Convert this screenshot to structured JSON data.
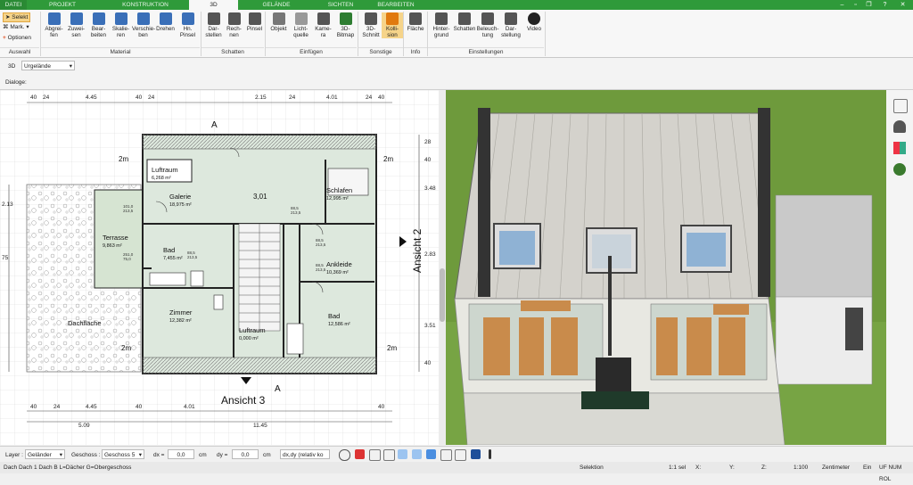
{
  "tabs": [
    {
      "label": "DATEI"
    },
    {
      "label": "PROJEKT"
    },
    {
      "label": "KONSTRUKTION"
    },
    {
      "label": "3D"
    },
    {
      "label": "GELÄNDE"
    },
    {
      "label": "SICHTEN"
    },
    {
      "label": "BEARBEITEN"
    }
  ],
  "ribbon": {
    "auswahl": {
      "selekt": "Selekt",
      "mark": "Mark.",
      "optionen": "Optionen",
      "group": "Auswahl"
    },
    "material": {
      "group": "Material",
      "buttons": [
        {
          "l1": "Abgrei-",
          "l2": "fen"
        },
        {
          "l1": "Zuwei-",
          "l2": "sen"
        },
        {
          "l1": "Bear-",
          "l2": "beiten"
        },
        {
          "l1": "Skalie-",
          "l2": "ren"
        },
        {
          "l1": "Verschie-",
          "l2": "ben"
        },
        {
          "l1": "Drehen",
          "l2": ""
        },
        {
          "l1": "Hn.",
          "l2": "Pinsel"
        }
      ]
    },
    "schatten": {
      "group": "Schatten",
      "buttons": [
        {
          "l1": "Dar-",
          "l2": "stellen"
        },
        {
          "l1": "Rech-",
          "l2": "nen"
        },
        {
          "l1": "Pinsel",
          "l2": ""
        }
      ]
    },
    "einfuegen": {
      "group": "Einfügen",
      "buttons": [
        {
          "l1": "Objekt",
          "l2": ""
        },
        {
          "l1": "Licht-",
          "l2": "quelle"
        },
        {
          "l1": "Kame-",
          "l2": "ra"
        },
        {
          "l1": "3D-",
          "l2": "Bitmap"
        }
      ]
    },
    "sonstige": {
      "group": "Sonstige",
      "buttons": [
        {
          "l1": "3D-",
          "l2": "Schnitt"
        },
        {
          "l1": "Kolli-",
          "l2": "sion"
        }
      ]
    },
    "info": {
      "group": "Info",
      "buttons": [
        {
          "l1": "Fläche",
          "l2": ""
        }
      ]
    },
    "einstellungen": {
      "group": "Einstellungen",
      "buttons": [
        {
          "l1": "Hinter-",
          "l2": "grund"
        },
        {
          "l1": "Schatten",
          "l2": ""
        },
        {
          "l1": "Beleuch-",
          "l2": "tung"
        },
        {
          "l1": "Dar-",
          "l2": "stellung"
        },
        {
          "l1": "Video",
          "l2": ""
        }
      ]
    }
  },
  "viewbar": {
    "mode": "3D",
    "terrain": "Urgelände"
  },
  "dialoge_label": "Dialoge:",
  "plan": {
    "dims_top": [
      "40",
      "24",
      "4.45",
      "40",
      "24",
      "2.15",
      "24",
      "4.01",
      "24",
      "40"
    ],
    "dims_bottom1": [
      "40",
      "24",
      "4.45",
      "40",
      "4.01",
      "40"
    ],
    "dims_bottom2": [
      "5.09",
      "11.45"
    ],
    "dims_right": [
      "28",
      "40",
      "3.48",
      "2.83",
      "3.51",
      "40"
    ],
    "dims_left": [
      "2.13",
      "75"
    ],
    "rooms": [
      {
        "name": "Luftraum",
        "area": "6,268 m²"
      },
      {
        "name": "Galerie",
        "area": "18,975 m²"
      },
      {
        "name": "Schlafen",
        "area": "12,995 m²"
      },
      {
        "name": "Terrasse",
        "area": "9,863 m²"
      },
      {
        "name": "Bad",
        "area": "7,455 m²"
      },
      {
        "name": "Ankleide",
        "area": "10,369 m²"
      },
      {
        "name": "Zimmer",
        "area": "12,382 m²"
      },
      {
        "name": "Luftraum",
        "area": "0,000 m²"
      },
      {
        "name": "Bad",
        "area": "12,586 m²"
      },
      {
        "name": "Dachfläche",
        "area": ""
      }
    ],
    "door_labels": [
      "101,0",
      "213,5",
      "251,0",
      "75,0",
      "88,5",
      "213,5",
      "88,5",
      "213,5",
      "88,5",
      "213,5",
      "88,5",
      "213,5"
    ],
    "height": "3,01",
    "section_a_top": "A",
    "section_a_bottom": "A",
    "ansicht2": "Ansicht 2",
    "ansicht3": "Ansicht 3",
    "marker_2m": "2m"
  },
  "bottombar": {
    "layer_label": "Layer :",
    "layer_value": "Geländer",
    "geschoss_label": "Geschoss :",
    "geschoss_value": "Geschoss 5",
    "dx_label": "dx =",
    "dx_value": "0,0",
    "dy_label": "dy =",
    "dy_value": "0,0",
    "unit": "cm",
    "mode_value": "dx,dy (relativ ko"
  },
  "status": {
    "left": "Dach Dach 1 Dach B L=Dächer G=Obergeschoss",
    "mode": "Selektion",
    "scale": "1:1 sel",
    "x_label": "X:",
    "y_label": "Y:",
    "z_label": "Z:",
    "zoom": "1:100",
    "unit": "Zentimeter",
    "ein": "Ein",
    "flags": "UF NUM ROL"
  },
  "colors": {
    "tabbar": "#2f9a3a",
    "grass": "#6e9a3c",
    "floor": "#c98b4b"
  }
}
